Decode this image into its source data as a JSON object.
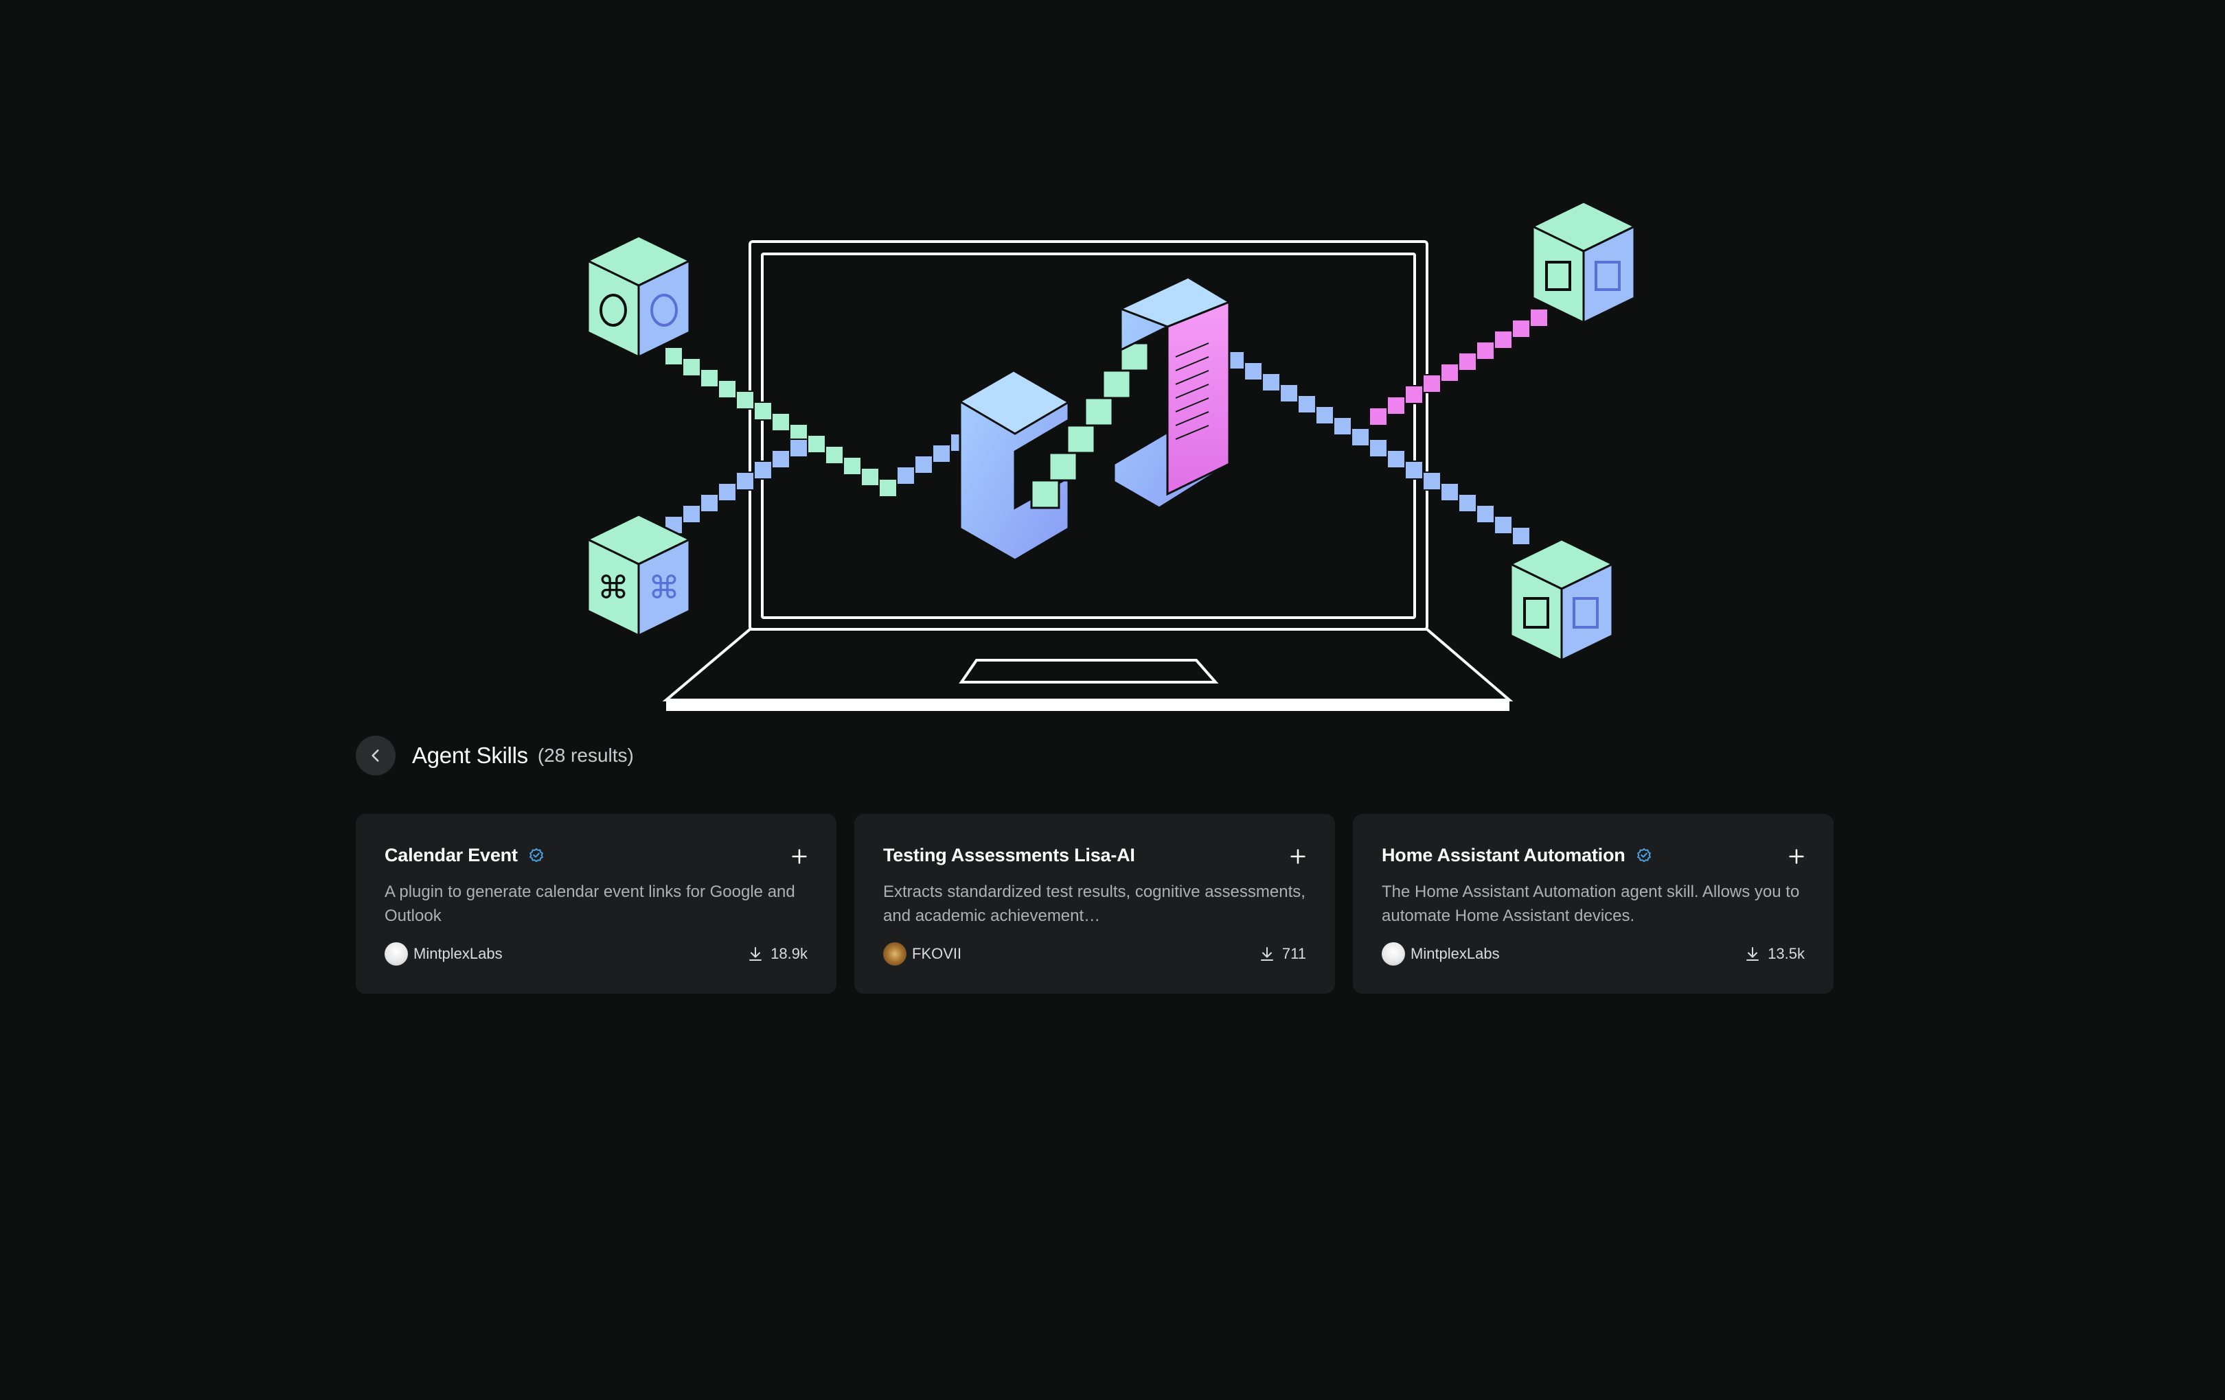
{
  "header": {
    "title": "Agent Skills",
    "count": "(28 results)"
  },
  "cards": [
    {
      "title": "Calendar Event",
      "verified": true,
      "description": "A plugin to generate calendar event links for Google and Outlook",
      "author": "MintplexLabs",
      "downloads": "18.9k"
    },
    {
      "title": "Testing Assessments Lisa-AI",
      "verified": false,
      "description": "Extracts standardized test results, cognitive assessments, and academic achievement…",
      "author": "FKOVII",
      "downloads": "711"
    },
    {
      "title": "Home Assistant Automation",
      "verified": true,
      "description": "The Home Assistant Automation agent skill. Allows you to automate Home Assistant devices.",
      "author": "MintplexLabs",
      "downloads": "13.5k"
    }
  ],
  "icons": {
    "back": "chevron-left-icon",
    "verified": "verified-badge-icon",
    "add": "plus-icon",
    "download": "download-icon"
  },
  "colors": {
    "background": "#0e1010",
    "card": "#1b1d1e",
    "mint": "#a8f0d0",
    "blue": "#9dbef8",
    "pink": "#ee82ee",
    "verified": "#4aa3e8"
  }
}
